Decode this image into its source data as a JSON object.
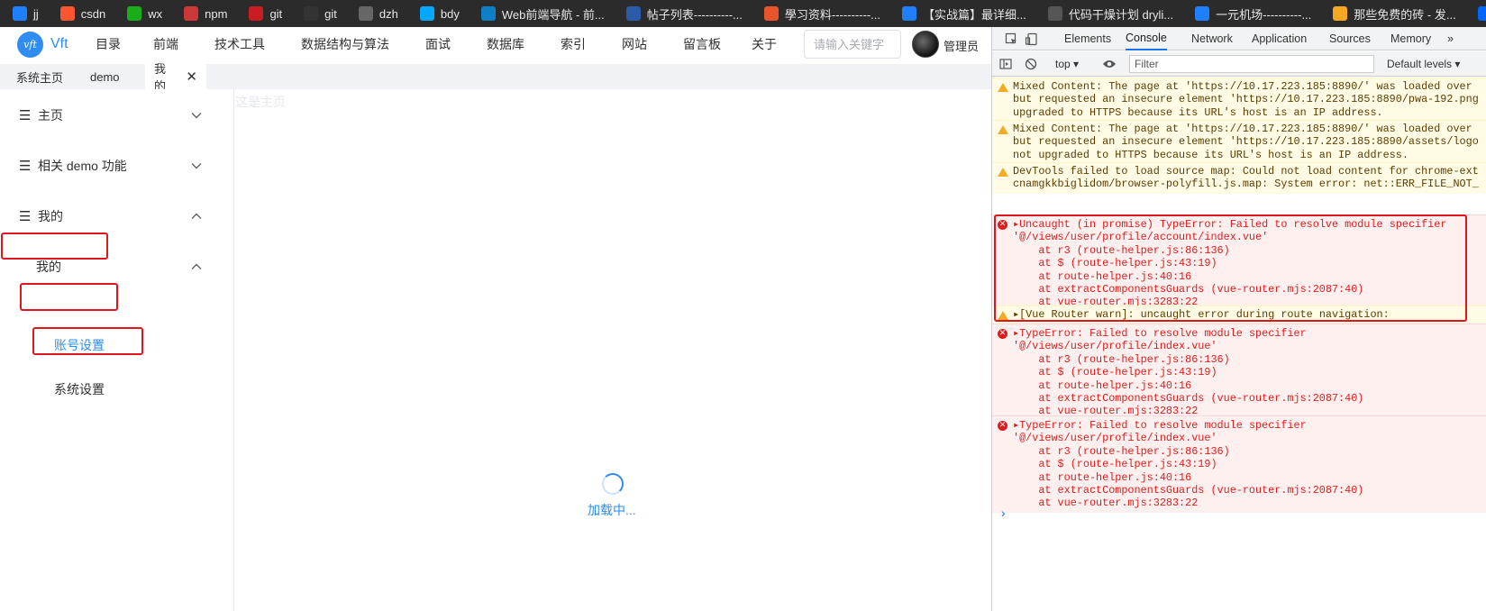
{
  "bookmarks": [
    {
      "label": "jj",
      "icon": "juejin-icon",
      "color": "#1e80ff"
    },
    {
      "label": "csdn",
      "icon": "csdn-icon",
      "color": "#fc5531"
    },
    {
      "label": "wx",
      "icon": "wechat-icon",
      "color": "#1aad19"
    },
    {
      "label": "npm",
      "icon": "npm-icon",
      "color": "#cb3837"
    },
    {
      "label": "git",
      "icon": "gitee-icon",
      "color": "#c71d23"
    },
    {
      "label": "git",
      "icon": "github-icon",
      "color": "#333333"
    },
    {
      "label": "dzh",
      "icon": "folder-icon",
      "color": "#666666"
    },
    {
      "label": "bdy",
      "icon": "baidu-cloud-icon",
      "color": "#06a7ff"
    },
    {
      "label": "Web前端导航 - 前...",
      "icon": "code-icon",
      "color": "#0e7fc7"
    },
    {
      "label": "帖子列表----------...",
      "icon": "forum-icon",
      "color": "#2b5aa8"
    },
    {
      "label": "學习资料----------...",
      "icon": "chart-icon",
      "color": "#e8552d"
    },
    {
      "label": "【实战篇】最详细...",
      "icon": "juejin-icon",
      "color": "#1e80ff"
    },
    {
      "label": "代码干燥计划 dryli...",
      "icon": "globe-icon",
      "color": "#555555"
    },
    {
      "label": "一元机场----------...",
      "icon": "juejin-icon",
      "color": "#1e80ff"
    },
    {
      "label": "那些免费的砖 - 发...",
      "icon": "brick-icon",
      "color": "#f5a623"
    },
    {
      "label": "----------",
      "icon": "zhihu-icon",
      "color": "#0066ff"
    }
  ],
  "app": {
    "logo_text": "Vft",
    "logo_mark": "vft",
    "menu": [
      "目录",
      "前端",
      "技术工具",
      "数据结构与算法",
      "面试",
      "数据库",
      "索引",
      "网站",
      "留言板",
      "关于"
    ],
    "search_placeholder": "请输入关键字",
    "user_name": "管理员",
    "tabs": [
      {
        "label": "系统主页"
      },
      {
        "label": "demo"
      },
      {
        "label": "我的",
        "active": true,
        "close": "✕"
      }
    ],
    "sidebar": {
      "hamburger": "☰",
      "items": [
        {
          "label": "主页",
          "expanded": false
        },
        {
          "label": "相关 demo 功能",
          "expanded": false
        },
        {
          "label": "我的",
          "expanded": true
        },
        {
          "label": "我的",
          "expanded": true
        },
        {
          "label": "账号设置",
          "active": true
        },
        {
          "label": "系统设置"
        }
      ]
    },
    "content": {
      "home_text": "这是主页",
      "loading_text": "加载中..."
    },
    "accent_color": "#2f8cf2",
    "highlight_color": "#e0161f"
  },
  "devtools": {
    "tabs": [
      "Elements",
      "Console",
      "Network",
      "Application",
      "Sources",
      "Memory",
      "»"
    ],
    "active_tab": "Console",
    "toolbar": {
      "context": "top ▾",
      "filter_placeholder": "Filter",
      "levels": "Default levels ▾"
    },
    "messages": [
      {
        "level": "warning",
        "lines": [
          "Mixed Content: The page at 'https://10.17.223.185:8890/' was loaded over",
          "but requested an insecure element 'https://10.17.223.185:8890/pwa-192.png",
          "upgraded to HTTPS because its URL's host is an IP address."
        ]
      },
      {
        "level": "warning",
        "lines": [
          "Mixed Content: The page at 'https://10.17.223.185:8890/' was loaded over",
          "but requested an insecure element 'https://10.17.223.185:8890/assets/logo",
          "not upgraded to HTTPS because its URL's host is an IP address."
        ]
      },
      {
        "level": "warning",
        "lines": [
          "DevTools failed to load source map: Could not load content for chrome-ext",
          "cnamgkkbiglidom/browser-polyfill.js.map: System error: net::ERR_FILE_NOT_"
        ]
      },
      {
        "level": "error",
        "lines": [
          "▸Uncaught (in promise) TypeError: Failed to resolve module specifier",
          "'@/views/user/profile/account/index.vue'",
          "    at r3 (route-helper.js:86:136)",
          "    at $ (route-helper.js:43:19)",
          "    at route-helper.js:40:16",
          "    at extractComponentsGuards (vue-router.mjs:2087:40)",
          "    at vue-router.mjs:3283:22"
        ]
      },
      {
        "level": "warning",
        "lines": [
          "▸[Vue Router warn]: uncaught error during route navigation:"
        ]
      },
      {
        "level": "error",
        "lines": [
          "▸TypeError: Failed to resolve module specifier",
          "'@/views/user/profile/index.vue'",
          "    at r3 (route-helper.js:86:136)",
          "    at $ (route-helper.js:43:19)",
          "    at route-helper.js:40:16",
          "    at extractComponentsGuards (vue-router.mjs:2087:40)",
          "    at vue-router.mjs:3283:22"
        ]
      },
      {
        "level": "error",
        "lines": [
          "▸TypeError: Failed to resolve module specifier",
          "'@/views/user/profile/index.vue'",
          "    at r3 (route-helper.js:86:136)",
          "    at $ (route-helper.js:43:19)",
          "    at route-helper.js:40:16",
          "    at extractComponentsGuards (vue-router.mjs:2087:40)",
          "    at vue-router.mjs:3283:22"
        ]
      }
    ],
    "prompt": "›"
  }
}
